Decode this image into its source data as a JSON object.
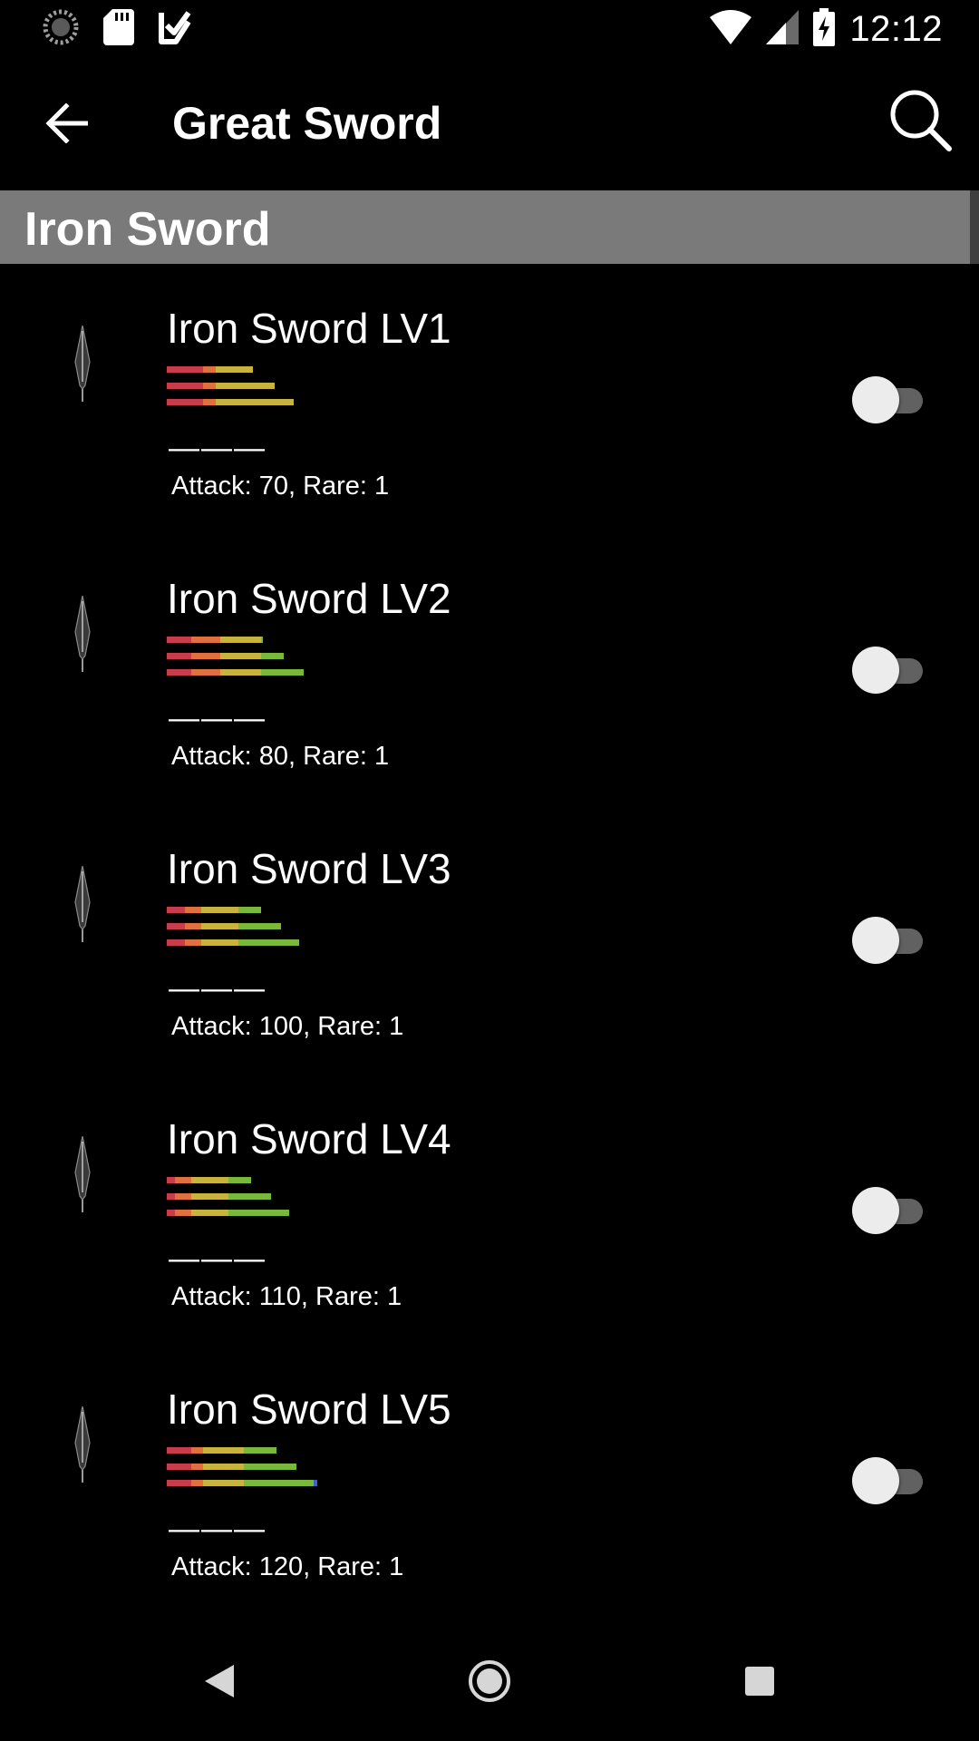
{
  "status_bar": {
    "time": "12:12",
    "left_icons": [
      "loading-circle-icon",
      "sd-card-icon",
      "check-notification-icon"
    ],
    "right_icons": [
      "wifi-icon",
      "cell-signal-icon",
      "battery-charging-icon"
    ]
  },
  "app_bar": {
    "title": "Great Sword",
    "back_icon": "arrow-back-icon",
    "search_icon": "search-icon"
  },
  "section": {
    "title": "Iron Sword"
  },
  "colors": {
    "background": "#000000",
    "section_header": "#7a7a7a",
    "toggle_track": "#616161",
    "toggle_thumb": "#ececec",
    "sharp_red": "#c83c4c",
    "sharp_orange": "#e0703e",
    "sharp_yellow": "#c8b43c",
    "sharp_green": "#7ab83c",
    "sharp_blue": "#3c64c8"
  },
  "items": [
    {
      "name": "Iron Sword LV1",
      "slots": "———",
      "stats": "Attack: 70, Rare: 1",
      "toggle_on": false,
      "sharpness": [
        [
          [
            "red",
            0.22
          ],
          [
            "orange",
            0.08
          ],
          [
            "yellow",
            0.23
          ]
        ],
        [
          [
            "red",
            0.22
          ],
          [
            "orange",
            0.08
          ],
          [
            "yellow",
            0.36
          ]
        ],
        [
          [
            "red",
            0.22
          ],
          [
            "orange",
            0.08
          ],
          [
            "yellow",
            0.48
          ]
        ]
      ]
    },
    {
      "name": "Iron Sword LV2",
      "slots": "———",
      "stats": "Attack: 80, Rare: 1",
      "toggle_on": false,
      "sharpness": [
        [
          [
            "red",
            0.15
          ],
          [
            "orange",
            0.18
          ],
          [
            "yellow",
            0.25
          ],
          [
            "green",
            0.01
          ]
        ],
        [
          [
            "red",
            0.15
          ],
          [
            "orange",
            0.18
          ],
          [
            "yellow",
            0.25
          ],
          [
            "green",
            0.14
          ]
        ],
        [
          [
            "red",
            0.15
          ],
          [
            "orange",
            0.18
          ],
          [
            "yellow",
            0.25
          ],
          [
            "green",
            0.26
          ]
        ]
      ]
    },
    {
      "name": "Iron Sword LV3",
      "slots": "———",
      "stats": "Attack: 100, Rare: 1",
      "toggle_on": false,
      "sharpness": [
        [
          [
            "red",
            0.11
          ],
          [
            "orange",
            0.1
          ],
          [
            "yellow",
            0.23
          ],
          [
            "green",
            0.14
          ]
        ],
        [
          [
            "red",
            0.11
          ],
          [
            "orange",
            0.1
          ],
          [
            "yellow",
            0.23
          ],
          [
            "green",
            0.26
          ]
        ],
        [
          [
            "red",
            0.11
          ],
          [
            "orange",
            0.1
          ],
          [
            "yellow",
            0.23
          ],
          [
            "green",
            0.37
          ]
        ]
      ]
    },
    {
      "name": "Iron Sword LV4",
      "slots": "———",
      "stats": "Attack: 110, Rare: 1",
      "toggle_on": false,
      "sharpness": [
        [
          [
            "red",
            0.05
          ],
          [
            "orange",
            0.1
          ],
          [
            "yellow",
            0.23
          ],
          [
            "green",
            0.14
          ]
        ],
        [
          [
            "red",
            0.05
          ],
          [
            "orange",
            0.1
          ],
          [
            "yellow",
            0.23
          ],
          [
            "green",
            0.26
          ]
        ],
        [
          [
            "red",
            0.05
          ],
          [
            "orange",
            0.1
          ],
          [
            "yellow",
            0.23
          ],
          [
            "green",
            0.37
          ]
        ]
      ]
    },
    {
      "name": "Iron Sword LV5",
      "slots": "———",
      "stats": "Attack: 120, Rare: 1",
      "toggle_on": false,
      "sharpness": [
        [
          [
            "red",
            0.15
          ],
          [
            "orange",
            0.07
          ],
          [
            "yellow",
            0.25
          ],
          [
            "green",
            0.2
          ]
        ],
        [
          [
            "red",
            0.15
          ],
          [
            "orange",
            0.07
          ],
          [
            "yellow",
            0.25
          ],
          [
            "green",
            0.32
          ]
        ],
        [
          [
            "red",
            0.15
          ],
          [
            "orange",
            0.07
          ],
          [
            "yellow",
            0.25
          ],
          [
            "green",
            0.43
          ],
          [
            "blue",
            0.02
          ]
        ]
      ]
    }
  ],
  "nav_bar": {
    "back_icon": "nav-back-icon",
    "home_icon": "nav-home-icon",
    "recents_icon": "nav-recents-icon"
  }
}
